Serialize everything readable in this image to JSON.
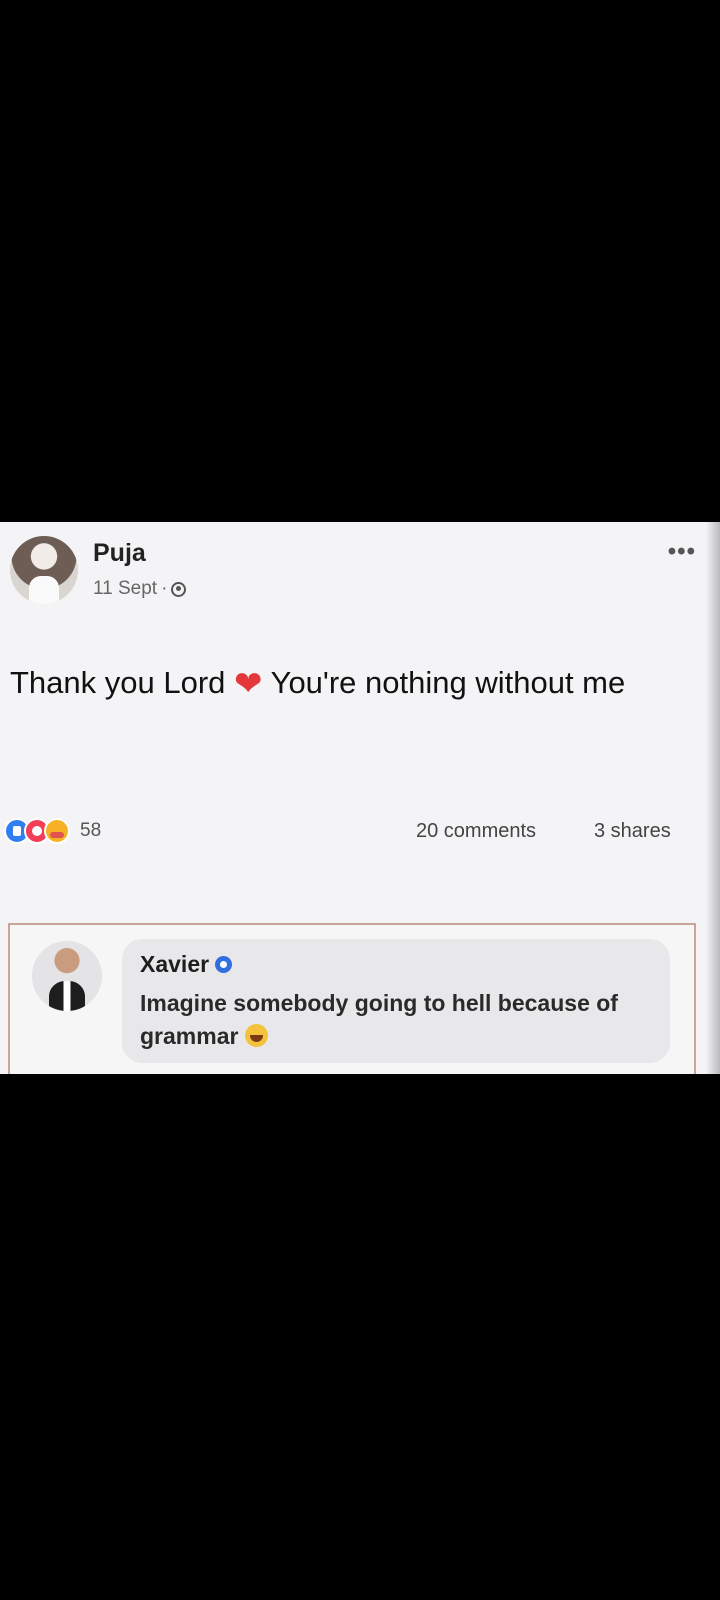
{
  "post": {
    "author": "Puja",
    "date": "11 Sept",
    "separator": "·",
    "privacy_icon": "globe-icon",
    "more_label": "•••",
    "text_part1": "Thank you Lord",
    "heart_glyph": "❤",
    "text_part2": "You're nothing without me"
  },
  "reactions": {
    "icons": [
      "like-icon",
      "love-icon",
      "care-icon"
    ],
    "count": "58",
    "comments": "20 comments",
    "shares": "3 shares"
  },
  "comment": {
    "author": "Xavier",
    "verified_icon": "verified-badge-icon",
    "text": "Imagine somebody going to hell because of grammar",
    "emoji": "laughing-emoji-icon"
  },
  "colors": {
    "background": "#000000",
    "card": "#f4f4f6",
    "heart": "#e3373b",
    "verified": "#2f6fe0"
  }
}
